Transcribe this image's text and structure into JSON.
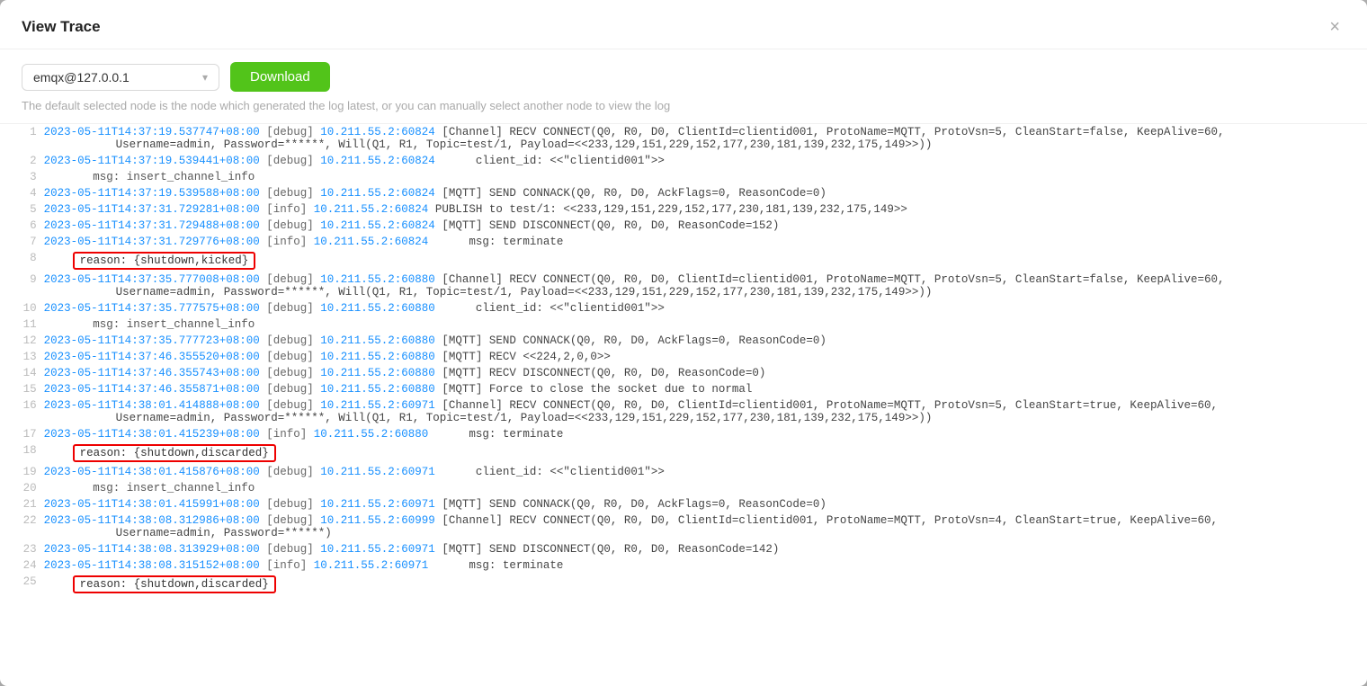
{
  "modal": {
    "title": "View Trace",
    "close_label": "×"
  },
  "toolbar": {
    "node_value": "emqx@127.0.0.1",
    "download_label": "Download",
    "hint": "The default selected node is the node which generated the log latest, or you can manually select another node to view the log"
  },
  "log_lines": [
    {
      "num": "1",
      "content": "2023-05-11T14:37:19.537747+08:00 [debug] 10.211.55.2:60824 [Channel] RECV CONNECT(Q0, R0, D0, ClientId=clientid001, ProtoName=MQTT, ProtoVsn=5, CleanStart=false, KeepAlive=60,",
      "continuation": "Username=admin, Password=******, Will(Q1, R1, Topic=test/1, Payload=<<233,129,151,229,152,177,230,181,139,232,175,149>>))",
      "ts": "2023-05-11T14:37:19.537747+08:00",
      "level": "[debug]",
      "ip": "10.211.55.2:60824",
      "rest": "[Channel] RECV CONNECT(Q0, R0, D0, ClientId=clientid001, ProtoName=MQTT, ProtoVsn=5, CleanStart=false, KeepAlive=60,"
    },
    {
      "num": "2",
      "ts": "2023-05-11T14:37:19.539441+08:00",
      "level": "[debug]",
      "ip": "10.211.55.2:60824",
      "rest": "     client_id: <<\"clientid001\">>"
    },
    {
      "num": "3",
      "indent": true,
      "rest": "msg: insert_channel_info"
    },
    {
      "num": "4",
      "ts": "2023-05-11T14:37:19.539588+08:00",
      "level": "[debug]",
      "ip": "10.211.55.2:60824",
      "rest": "[MQTT] SEND CONNACK(Q0, R0, D0, AckFlags=0, ReasonCode=0)"
    },
    {
      "num": "5",
      "ts": "2023-05-11T14:37:31.729281+08:00",
      "level": "[info]",
      "ip": "10.211.55.2:60824",
      "rest": "PUBLISH to test/1: <<233,129,151,229,152,177,230,181,139,232,175,149>>"
    },
    {
      "num": "6",
      "ts": "2023-05-11T14:37:31.729488+08:00",
      "level": "[debug]",
      "ip": "10.211.55.2:60824",
      "rest": "[MQTT] SEND DISCONNECT(Q0, R0, D0, ReasonCode=152)"
    },
    {
      "num": "7",
      "ts": "2023-05-11T14:37:31.729776+08:00",
      "level": "[info]",
      "ip": "10.211.55.2:60824",
      "rest": "     msg: terminate"
    },
    {
      "num": "8",
      "indent": true,
      "highlight": true,
      "rest": "reason: {shutdown,kicked}"
    },
    {
      "num": "9",
      "ts": "2023-05-11T14:37:35.777008+08:00",
      "level": "[debug]",
      "ip": "10.211.55.2:60880",
      "rest": "[Channel] RECV CONNECT(Q0, R0, D0, ClientId=clientid001, ProtoName=MQTT, ProtoVsn=5, CleanStart=false, KeepAlive=60,",
      "continuation": "Username=admin, Password=******, Will(Q1, R1, Topic=test/1, Payload=<<233,129,151,229,152,177,230,181,139,232,175,149>>))"
    },
    {
      "num": "10",
      "ts": "2023-05-11T14:37:35.777575+08:00",
      "level": "[debug]",
      "ip": "10.211.55.2:60880",
      "rest": "     client_id: <<\"clientid001\">>"
    },
    {
      "num": "11",
      "indent": true,
      "rest": "msg: insert_channel_info"
    },
    {
      "num": "12",
      "ts": "2023-05-11T14:37:35.777723+08:00",
      "level": "[debug]",
      "ip": "10.211.55.2:60880",
      "rest": "[MQTT] SEND CONNACK(Q0, R0, D0, AckFlags=0, ReasonCode=0)"
    },
    {
      "num": "13",
      "ts": "2023-05-11T14:37:46.355520+08:00",
      "level": "[debug]",
      "ip": "10.211.55.2:60880",
      "rest": "[MQTT] RECV <<224,2,0,0>>"
    },
    {
      "num": "14",
      "ts": "2023-05-11T14:37:46.355743+08:00",
      "level": "[debug]",
      "ip": "10.211.55.2:60880",
      "rest": "[MQTT] RECV DISCONNECT(Q0, R0, D0, ReasonCode=0)"
    },
    {
      "num": "15",
      "ts": "2023-05-11T14:37:46.355871+08:00",
      "level": "[debug]",
      "ip": "10.211.55.2:60880",
      "rest": "[MQTT] Force to close the socket due to normal"
    },
    {
      "num": "16",
      "ts": "2023-05-11T14:38:01.414888+08:00",
      "level": "[debug]",
      "ip": "10.211.55.2:60971",
      "rest": "[Channel] RECV CONNECT(Q0, R0, D0, ClientId=clientid001, ProtoName=MQTT, ProtoVsn=5, CleanStart=true, KeepAlive=60,",
      "continuation": "Username=admin, Password=******, Will(Q1, R1, Topic=test/1, Payload=<<233,129,151,229,152,177,230,181,139,232,175,149>>))"
    },
    {
      "num": "17",
      "ts": "2023-05-11T14:38:01.415239+08:00",
      "level": "[info]",
      "ip": "10.211.55.2:60880",
      "rest": "     msg: terminate"
    },
    {
      "num": "18",
      "indent": true,
      "highlight": true,
      "rest": "reason: {shutdown,discarded}"
    },
    {
      "num": "19",
      "ts": "2023-05-11T14:38:01.415876+08:00",
      "level": "[debug]",
      "ip": "10.211.55.2:60971",
      "rest": "     client_id: <<\"clientid001\">>"
    },
    {
      "num": "20",
      "indent": true,
      "rest": "msg: insert_channel_info"
    },
    {
      "num": "21",
      "ts": "2023-05-11T14:38:01.415991+08:00",
      "level": "[debug]",
      "ip": "10.211.55.2:60971",
      "rest": "[MQTT] SEND CONNACK(Q0, R0, D0, AckFlags=0, ReasonCode=0)"
    },
    {
      "num": "22",
      "ts": "2023-05-11T14:38:08.312986+08:00",
      "level": "[debug]",
      "ip": "10.211.55.2:60999",
      "rest": "[Channel] RECV CONNECT(Q0, R0, D0, ClientId=clientid001, ProtoName=MQTT, ProtoVsn=4, CleanStart=true, KeepAlive=60,",
      "continuation": "Username=admin, Password=******)"
    },
    {
      "num": "23",
      "ts": "2023-05-11T14:38:08.313929+08:00",
      "level": "[debug]",
      "ip": "10.211.55.2:60971",
      "rest": "[MQTT] SEND DISCONNECT(Q0, R0, D0, ReasonCode=142)"
    },
    {
      "num": "24",
      "ts": "2023-05-11T14:38:08.315152+08:00",
      "level": "[info]",
      "ip": "10.211.55.2:60971",
      "rest": "     msg: terminate"
    },
    {
      "num": "25",
      "indent": true,
      "highlight": true,
      "rest": "reason: {shutdown,discarded}"
    }
  ]
}
